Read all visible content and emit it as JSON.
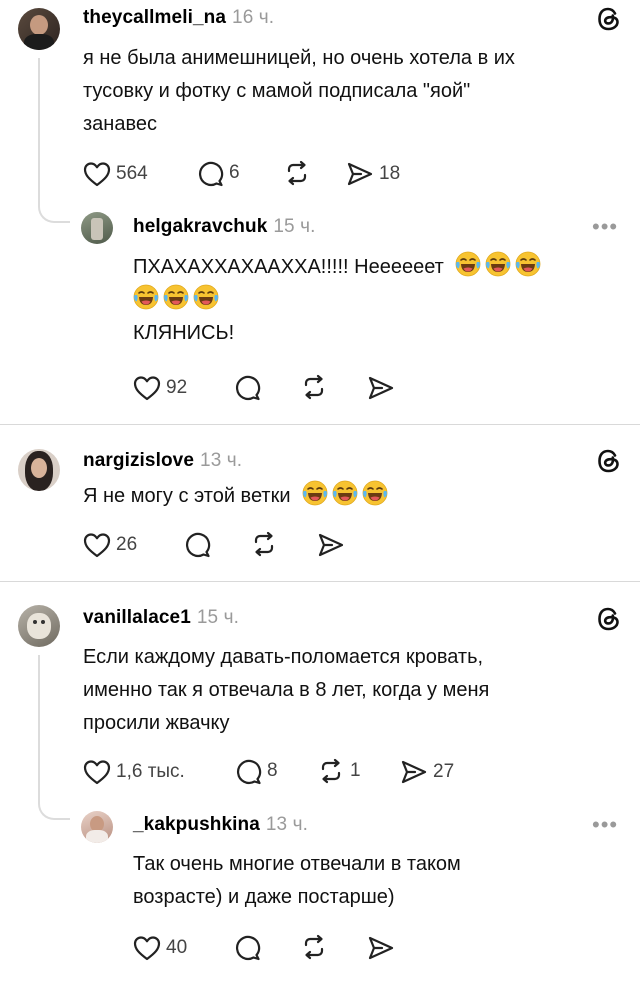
{
  "colors": {
    "text": "#111111",
    "muted": "#9a9a9a",
    "divider": "#d9d9d9",
    "emoji": "#f7c331"
  },
  "icons": {
    "like": "heart-icon",
    "reply": "comment-bubble-icon",
    "repost": "repost-icon",
    "share": "send-icon",
    "threads": "threads-logo-icon",
    "more": "more-dots-icon"
  },
  "posts": [
    {
      "username": "theycallmeli_na",
      "time": "16 ч.",
      "lines": [
        "я не была анимешницей, но очень хотела в их",
        "тусовку и фотку с мамой подписала \"яой\"",
        "занавес"
      ],
      "likes": "564",
      "replies": "6",
      "reposts": "",
      "shares": "18",
      "reply": {
        "username": "helgakravchuk",
        "time": "15 ч.",
        "more": "•••",
        "line1": "ПХАХАХХАХААХХА!!!!! Неееееет",
        "line3": "КЛЯНИСЬ!",
        "likes": "92"
      }
    },
    {
      "username": "nargizislove",
      "time": "13 ч.",
      "line1": "Я не могу с этой ветки",
      "likes": "26"
    },
    {
      "username": "vanillalace1",
      "time": "15 ч.",
      "lines": [
        "Если каждому давать-поломается кровать,",
        "именно так я отвечала в 8 лет, когда у меня",
        "просили жвачку"
      ],
      "likes": "1,6 тыс.",
      "replies": "8",
      "reposts": "1",
      "shares": "27",
      "reply": {
        "username": "_kakpushkina",
        "time": "13 ч.",
        "more": "•••",
        "lines": [
          "Так очень многие отвечали в таком",
          "возрасте) и даже постарше)"
        ],
        "likes": "40"
      }
    }
  ]
}
